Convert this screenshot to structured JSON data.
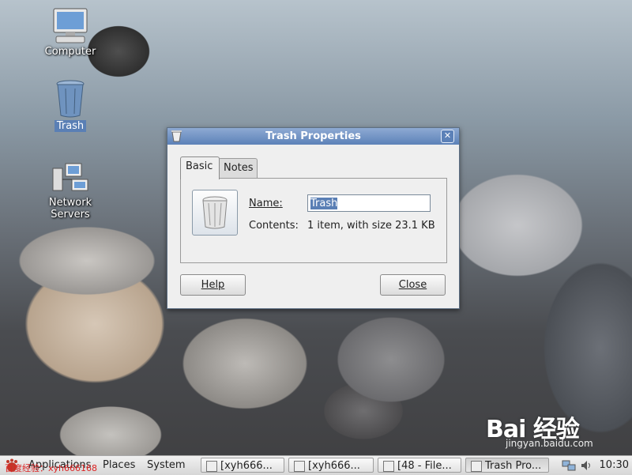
{
  "desktop": {
    "icons": [
      {
        "label": "Computer",
        "icon": "computer-icon"
      },
      {
        "label": "Trash",
        "icon": "trash-icon"
      },
      {
        "label": "Network Servers",
        "icon": "network-servers-icon"
      }
    ]
  },
  "dialog": {
    "title": "Trash Properties",
    "tabs": [
      "Basic",
      "Notes"
    ],
    "active_tab": "Basic",
    "name_label": "Name:",
    "name_value": "Trash",
    "contents_label": "Contents:",
    "contents_value": "1 item, with size 23.1 KB",
    "help_button": "Help",
    "close_button": "Close"
  },
  "taskbar": {
    "menus": [
      "Applications",
      "Places",
      "System"
    ],
    "tasks": [
      "[xyh666...",
      "[xyh666...",
      "[48 - File...",
      "Trash Pro..."
    ],
    "clock": "10:30"
  },
  "watermark": {
    "overlay_text": "百度经验：xyh666168",
    "logo_text": "Bai 经验",
    "logo_url": "jingyan.baidu.com"
  },
  "colors": {
    "titlebar": "#5c81b8",
    "selection": "#5a7fb5"
  }
}
